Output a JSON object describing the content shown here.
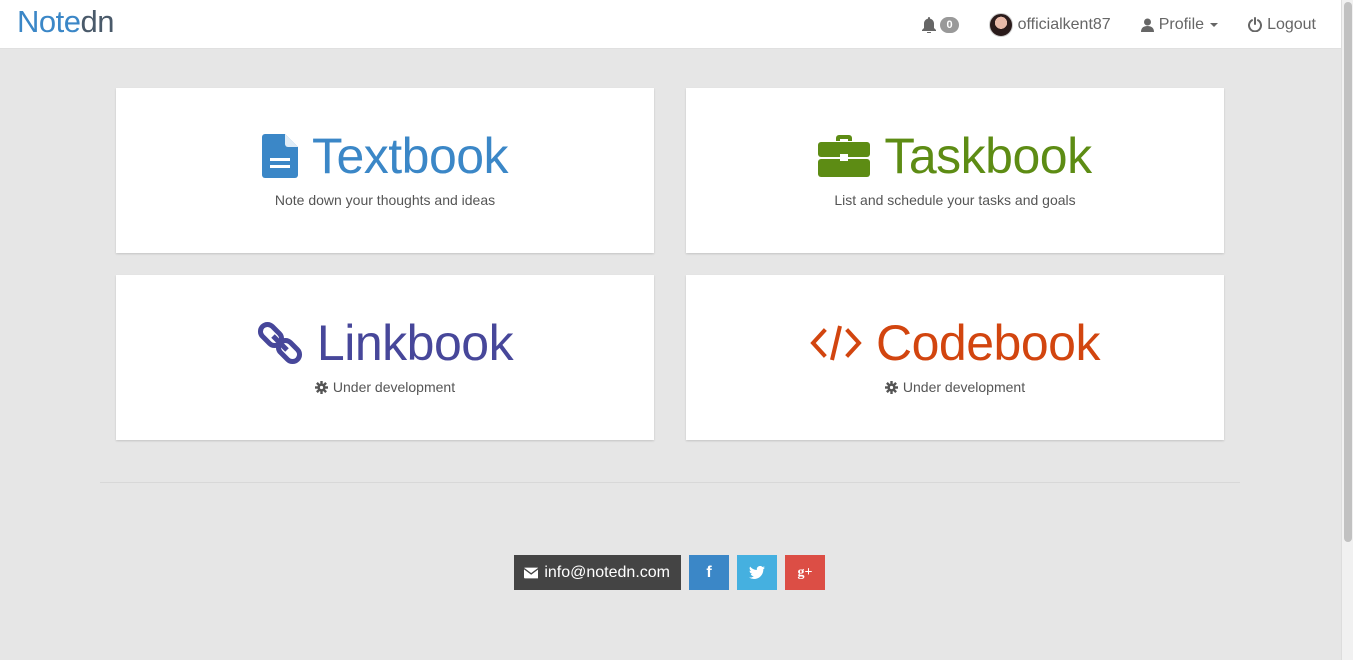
{
  "brand": {
    "main": "Note",
    "tail": "dn"
  },
  "nav": {
    "notifications_count": "0",
    "username": "officialkent87",
    "profile_label": "Profile",
    "logout_label": "Logout"
  },
  "cards": [
    {
      "title": "Textbook",
      "desc": "Note down your thoughts and ideas",
      "icon": "file-icon",
      "color": "#3b87c7"
    },
    {
      "title": "Taskbook",
      "desc": "List and schedule your tasks and goals",
      "icon": "briefcase-icon",
      "color": "#5d8c14"
    },
    {
      "title": "Linkbook",
      "desc": "Under development",
      "icon": "link-icon",
      "color": "#47479a"
    },
    {
      "title": "Codebook",
      "desc": "Under development",
      "icon": "code-icon",
      "color": "#d2450f"
    }
  ],
  "footer": {
    "email": "info@notedn.com",
    "facebook": "f",
    "twitter": "twitter-icon",
    "googleplus": "g+"
  }
}
